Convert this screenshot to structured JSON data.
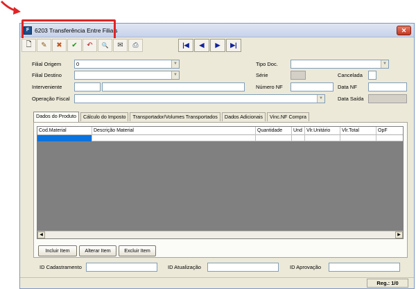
{
  "window": {
    "title": "6203 Transferência Entre Filiais",
    "app_icon": "app-icon",
    "close_label": "✕"
  },
  "toolbar": {
    "buttons": [
      {
        "icon": "new-document-icon",
        "glyph": "🗋"
      },
      {
        "icon": "edit-icon",
        "glyph": "✎"
      },
      {
        "icon": "delete-icon",
        "glyph": "✖"
      },
      {
        "icon": "confirm-icon",
        "glyph": "✔"
      },
      {
        "icon": "undo-icon",
        "glyph": "↶"
      },
      {
        "icon": "search-icon",
        "glyph": "🔍"
      },
      {
        "icon": "attachment-icon",
        "glyph": "✉"
      },
      {
        "icon": "print-icon",
        "glyph": "⎙"
      }
    ],
    "nav": [
      {
        "icon": "first-record-icon",
        "glyph": "|◀"
      },
      {
        "icon": "previous-record-icon",
        "glyph": "◀"
      },
      {
        "icon": "next-record-icon",
        "glyph": "▶"
      },
      {
        "icon": "last-record-icon",
        "glyph": "▶|"
      }
    ]
  },
  "form": {
    "filial_origem": {
      "label": "Filial Origem",
      "value": "0"
    },
    "filial_destino": {
      "label": "Filial Destino",
      "value": ""
    },
    "interveniente": {
      "label": "Interveniente",
      "code": "",
      "name": ""
    },
    "operacao_fiscal": {
      "label": "Operação Fiscal",
      "value": ""
    },
    "tipo_doc": {
      "label": "Tipo Doc.",
      "value": ""
    },
    "serie": {
      "label": "Série",
      "value": ""
    },
    "cancelada": {
      "label": "Cancelada",
      "value": ""
    },
    "numero_nf": {
      "label": "Número NF",
      "value": ""
    },
    "data_nf": {
      "label": "Data NF",
      "value": ""
    },
    "data_saida": {
      "label": "Data Saída",
      "value": ""
    }
  },
  "tabs": [
    "Dados do Produto",
    "Cálculo do Imposto",
    "Transportador/Volumes Transportados",
    "Dados Adicionais",
    "Vinc.NF Compra"
  ],
  "grid": {
    "columns": [
      "Cod.Material",
      "Descrição Material",
      "Quantidade",
      "Und",
      "Vlr.Unitário",
      "Vlr.Total",
      "OpF"
    ],
    "rows": [
      [
        "",
        "",
        "",
        "",
        "",
        "",
        ""
      ]
    ]
  },
  "panel_buttons": {
    "include": "Incluir Item",
    "change": "Alterar Item",
    "delete": "Excluir Item"
  },
  "audit": {
    "cadastramento": {
      "label": "ID Cadastramento",
      "value": ""
    },
    "atualizacao": {
      "label": "ID Atualização",
      "value": ""
    },
    "aprovacao": {
      "label": "ID Aprovação",
      "value": ""
    }
  },
  "status": {
    "record_counter": "Reg.: 1/0"
  },
  "colors": {
    "highlight": "#e02424",
    "selection": "#0a73e0",
    "grid_bg": "#808080",
    "window_bg": "#ece9d8"
  }
}
